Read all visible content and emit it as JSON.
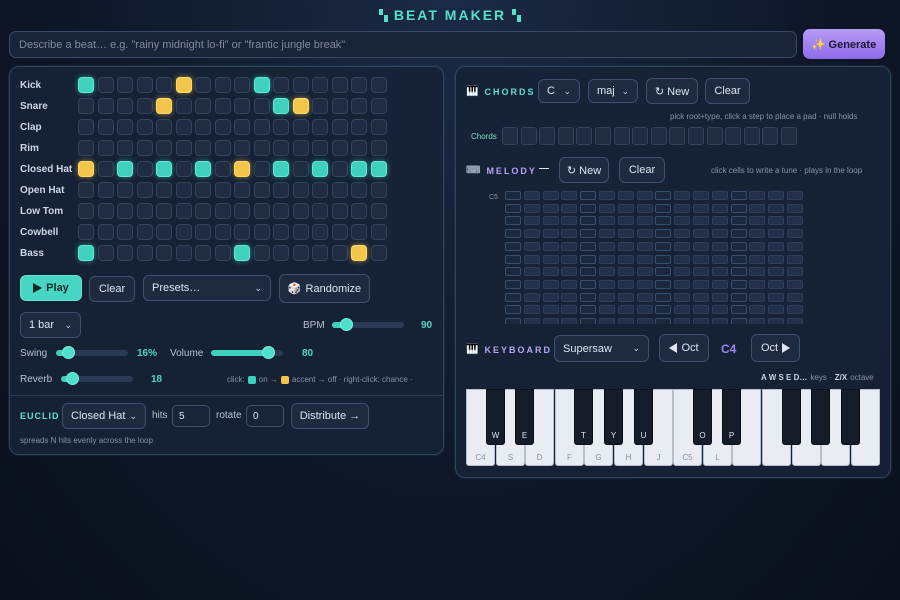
{
  "app_title": "BEAT MAKER",
  "prompt": {
    "placeholder": "Describe a beat… e.g. \"rainy midnight lo-fi\" or \"frantic jungle break\"",
    "generate_label": "✨ Generate"
  },
  "sequencer": {
    "tracks": [
      {
        "name": "Kick",
        "steps": [
          1,
          0,
          0,
          0,
          0,
          2,
          0,
          0,
          0,
          1,
          0,
          0,
          0,
          0,
          0,
          0
        ]
      },
      {
        "name": "Snare",
        "steps": [
          0,
          0,
          0,
          0,
          2,
          0,
          0,
          0,
          0,
          0,
          1,
          2,
          0,
          0,
          0,
          0
        ]
      },
      {
        "name": "Clap",
        "steps": [
          0,
          0,
          0,
          0,
          0,
          0,
          0,
          0,
          0,
          0,
          0,
          0,
          0,
          0,
          0,
          0
        ]
      },
      {
        "name": "Rim",
        "steps": [
          0,
          0,
          0,
          0,
          0,
          0,
          0,
          0,
          0,
          0,
          0,
          0,
          0,
          0,
          0,
          0
        ]
      },
      {
        "name": "Closed Hat",
        "steps": [
          2,
          0,
          1,
          0,
          1,
          0,
          1,
          0,
          2,
          0,
          1,
          0,
          1,
          0,
          1,
          1
        ]
      },
      {
        "name": "Open Hat",
        "steps": [
          0,
          0,
          0,
          0,
          0,
          0,
          0,
          0,
          0,
          0,
          0,
          0,
          0,
          0,
          0,
          0
        ]
      },
      {
        "name": "Low Tom",
        "steps": [
          0,
          0,
          0,
          0,
          0,
          0,
          0,
          0,
          0,
          0,
          0,
          0,
          0,
          0,
          0,
          0
        ]
      },
      {
        "name": "Cowbell",
        "steps": [
          0,
          0,
          0,
          0,
          0,
          0,
          0,
          0,
          0,
          0,
          0,
          0,
          0,
          0,
          0,
          0
        ]
      },
      {
        "name": "Bass",
        "steps": [
          1,
          0,
          0,
          0,
          0,
          0,
          0,
          0,
          1,
          0,
          0,
          0,
          0,
          0,
          2,
          0
        ]
      }
    ],
    "play_label": "Play",
    "clear_label": "Clear",
    "presets_label": "Presets…",
    "randomize_label": "Randomize",
    "bars_label": "1 bar",
    "bpm_label": "BPM",
    "bpm": 90,
    "swing_label": "Swing",
    "swing_value": "16%",
    "swing_level": 0.16,
    "volume_label": "Volume",
    "volume": 80,
    "reverb_label": "Reverb",
    "reverb": 18,
    "legend_prefix": "click:",
    "legend_on": "on →",
    "legend_accent": "accent → off · right-click: chance ·",
    "colors": {
      "on": "#3fd1bd",
      "accent": "#f2c64a"
    }
  },
  "euclid": {
    "title": "EUCLID",
    "track": "Closed Hat",
    "hits_label": "hits",
    "hits": "5",
    "rotate_label": "rotate",
    "rotate": "0",
    "distribute_label": "Distribute →",
    "hint": "spreads N hits evenly across the loop"
  },
  "chords": {
    "title": "CHORDS",
    "root": "C",
    "type": "maj",
    "new_label": "↻ New",
    "clear_label": "Clear",
    "hint": "pick root+type, click a step to place a pad · null holds",
    "row_label": "Chords"
  },
  "melody": {
    "title": "MELODY",
    "dash": "—",
    "new_label": "↻ New",
    "clear_label": "Clear",
    "hint": "click cells to write a tune · plays in the loop",
    "top_note": "C5"
  },
  "keyboard": {
    "title": "KEYBOARD",
    "patch": "Supersaw",
    "oct_down_label": "Oct",
    "octave": "C4",
    "oct_up_label": "Oct",
    "hint_keys": "A W S E D…",
    "hint_keys_suffix": "keys ·",
    "hint_oct": "Z/X",
    "hint_oct_suffix": "octave",
    "white_keys": [
      "C4",
      "S",
      "D",
      "F",
      "G",
      "H",
      "J",
      "C5",
      "L",
      "",
      "",
      "",
      "",
      ""
    ],
    "black_keys": [
      "W",
      "E",
      "T",
      "Y",
      "U",
      "O",
      "P",
      "",
      "",
      ""
    ]
  }
}
